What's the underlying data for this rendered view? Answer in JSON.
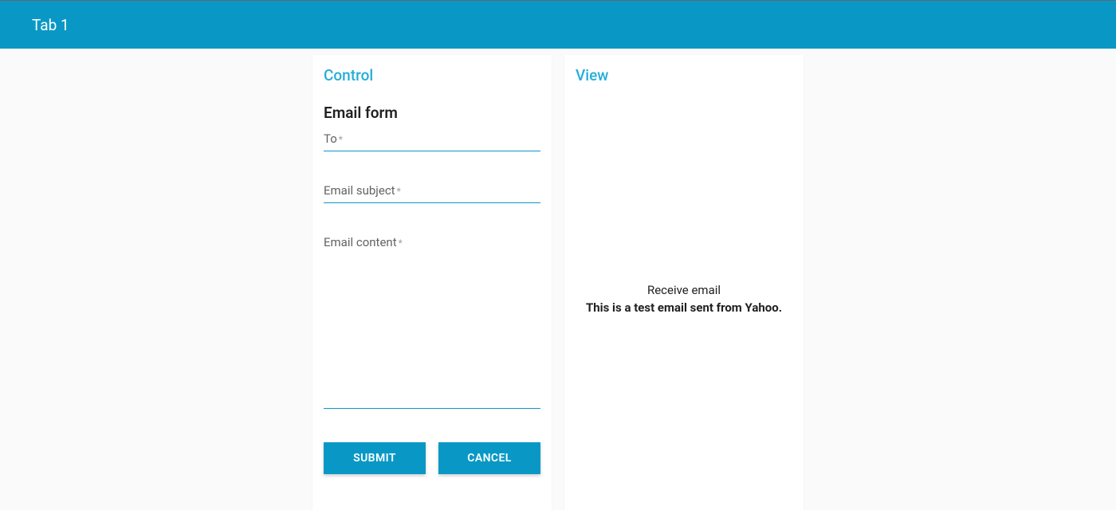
{
  "header": {
    "tab_label": "Tab 1"
  },
  "control": {
    "title": "Control",
    "form_heading": "Email form",
    "fields": {
      "to": {
        "label": "To",
        "required_mark": "*",
        "value": ""
      },
      "subject": {
        "label": "Email subject",
        "required_mark": "*",
        "value": ""
      },
      "content": {
        "label": "Email content",
        "required_mark": "*",
        "value": ""
      }
    },
    "buttons": {
      "submit": "SUBMIT",
      "cancel": "CANCEL"
    }
  },
  "view": {
    "title": "View",
    "caption": "Receive email",
    "message": "This is a test email sent from Yahoo."
  },
  "colors": {
    "brand": "#0998c5",
    "accent_text": "#24aed8"
  }
}
